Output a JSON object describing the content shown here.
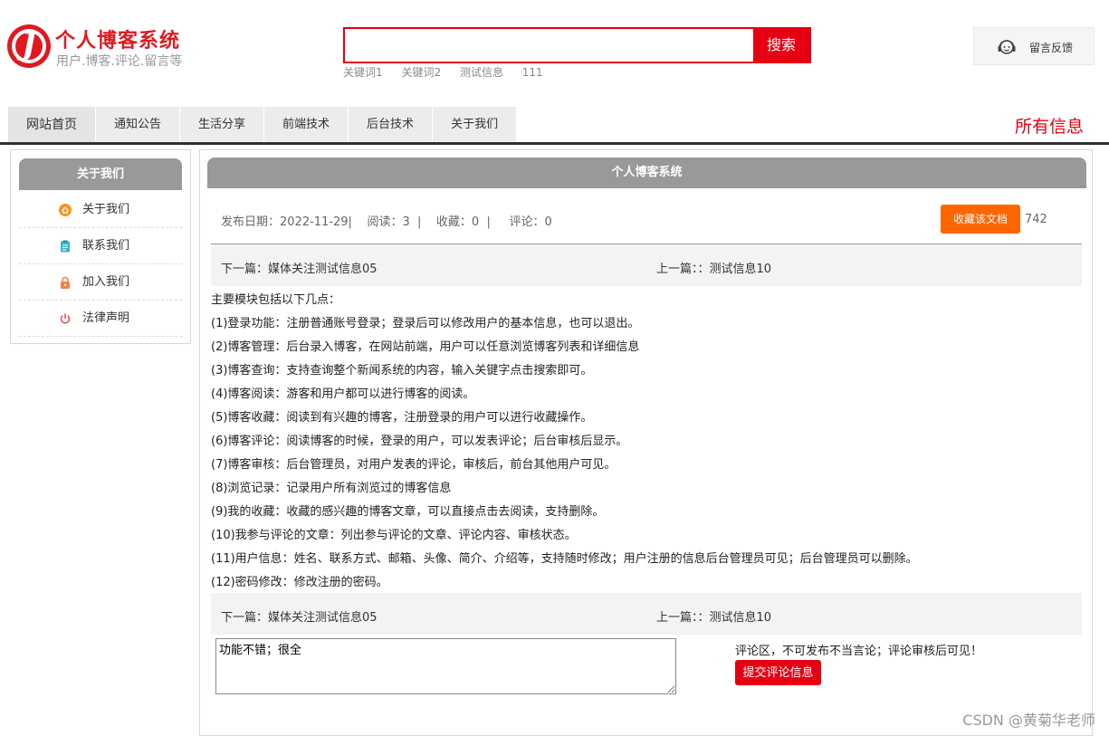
{
  "header": {
    "title": "个人博客系统",
    "subtitle": "用户.博客.评论.留言等",
    "search": {
      "value": "",
      "placeholder": "",
      "button": "搜索"
    },
    "keywords": [
      "关键词1",
      "关键词2",
      "测试信息",
      "111"
    ],
    "feedback": {
      "label": "留言反馈",
      "icon": "headset-icon"
    }
  },
  "nav": {
    "items": [
      "网站首页",
      "通知公告",
      "生活分享",
      "前端技术",
      "后台技术",
      "关于我们"
    ],
    "right_title": "所有信息"
  },
  "sidebar": {
    "title": "关于我们",
    "items": [
      {
        "label": "关于我们",
        "icon": "home-icon",
        "color": "#f7941d"
      },
      {
        "label": "联系我们",
        "icon": "clipboard-icon",
        "color": "#3cb4c8"
      },
      {
        "label": "加入我们",
        "icon": "lock-icon",
        "color": "#f0814a"
      },
      {
        "label": "法律声明",
        "icon": "power-icon",
        "color": "#e05a5a"
      }
    ]
  },
  "article": {
    "title": "个人博客系统",
    "meta": "发布日期：2022-11-29|    阅读：3  |    收藏：0  |     评论：0",
    "favorite_button": "收藏该文档",
    "favorite_count": "742",
    "next": "下一篇：媒体关注测试信息05",
    "prev": "上一篇：：测试信息10",
    "paragraphs": [
      "主要模块包括以下几点：",
      " (1)登录功能：注册普通账号登录；登录后可以修改用户的基本信息，也可以退出。",
      "(2)博客管理：后台录入博客，在网站前端，用户可以任意浏览博客列表和详细信息",
      " (3)博客查询：支持查询整个新闻系统的内容，输入关键字点击搜索即可。",
      " (4)博客阅读：游客和用户都可以进行博客的阅读。",
      " (5)博客收藏：阅读到有兴趣的博客，注册登录的用户可以进行收藏操作。",
      "(6)博客评论：阅读博客的时候，登录的用户，可以发表评论；后台审核后显示。",
      " (7)博客审核：后台管理员，对用户发表的评论，审核后，前台其他用户可见。",
      " (8)浏览记录：记录用户所有浏览过的博客信息",
      " (9)我的收藏：收藏的感兴趣的博客文章，可以直接点击去阅读，支持删除。",
      " (10)我参与评论的文章：列出参与评论的文章、评论内容、审核状态。",
      "(11)用户信息：姓名、联系方式、邮箱、头像、简介、介绍等，支持随时修改；用户注册的信息后台管理员可见；后台管理员可以删除。",
      " (12)密码修改：修改注册的密码。"
    ]
  },
  "comment": {
    "value": "功能不错；很全",
    "note": "评论区，不可发布不当言论；评论审核后可见！",
    "submit": "提交评论信息"
  },
  "watermark": "CSDN @黄菊华老师",
  "colors": {
    "brand_red": "#e60012",
    "orange": "#ff6600",
    "header_gray": "#999999"
  }
}
